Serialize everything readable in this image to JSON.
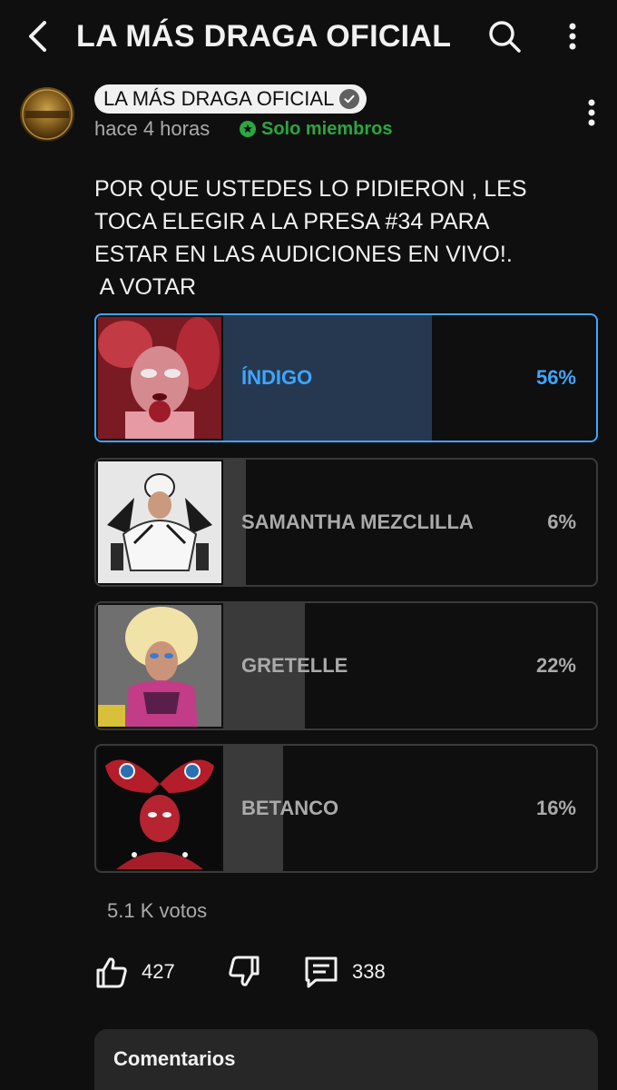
{
  "header": {
    "title": "LA MÁS DRAGA OFICIAL",
    "back_icon": "chevron-left-icon",
    "search_icon": "search-icon",
    "more_icon": "more-vertical-icon"
  },
  "post": {
    "channel_name": "LA MÁS DRAGA OFICIAL",
    "verified": true,
    "timestamp": "hace 4 horas",
    "members_badge": "Solo miembros",
    "text_lines": [
      "POR QUE USTEDES LO PIDIERON , LES",
      "TOCA ELEGIR A LA PRESA #34 PARA",
      "ESTAR EN LAS AUDICIONES EN VIVO!.",
      " A VOTAR"
    ]
  },
  "poll": {
    "options": [
      {
        "label": "ÍNDIGO",
        "percent_label": "56%",
        "percent": 56,
        "selected": true
      },
      {
        "label": "SAMANTHA MEZCLILLA",
        "percent_label": "6%",
        "percent": 6,
        "selected": false
      },
      {
        "label": "GRETELLE",
        "percent_label": "22%",
        "percent": 22,
        "selected": false
      },
      {
        "label": "BETANCO",
        "percent_label": "16%",
        "percent": 16,
        "selected": false
      }
    ],
    "votes_label": "5.1 K votos"
  },
  "actions": {
    "like_count": "427",
    "comment_count": "338"
  },
  "comments": {
    "title": "Comentarios"
  },
  "colors": {
    "background": "#0f0f0f",
    "accent_blue": "#3ea6ff",
    "members_green": "#2ba640",
    "muted_text": "#aaaaaa"
  }
}
